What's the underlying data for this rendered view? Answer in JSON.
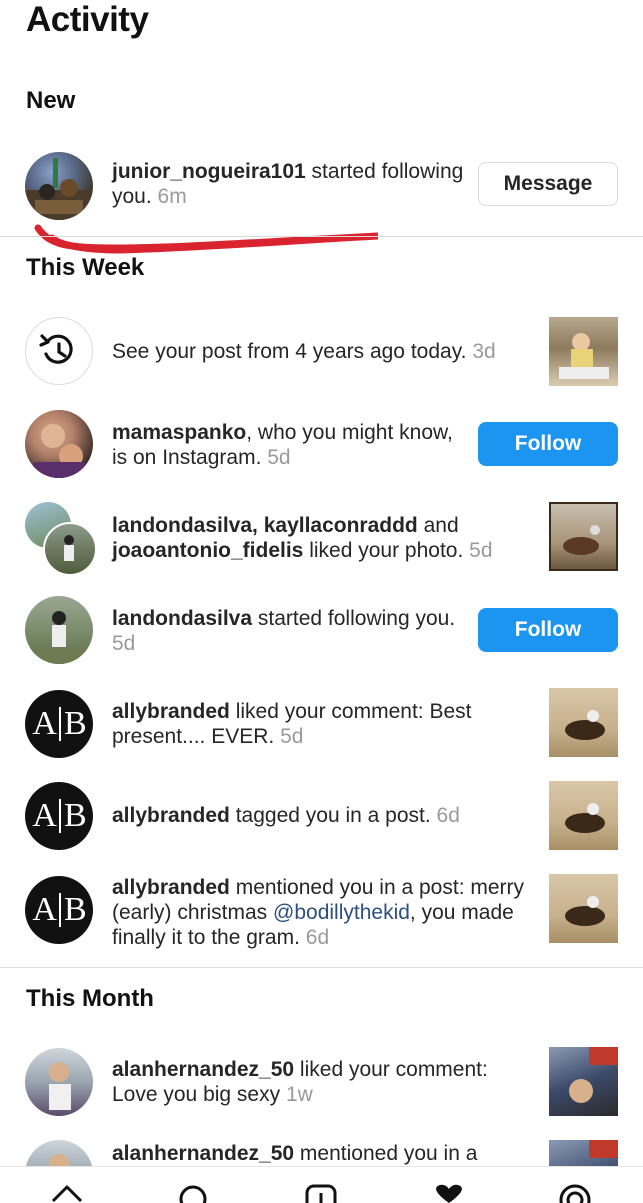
{
  "header": {
    "title": "Activity"
  },
  "sections": {
    "new": "New",
    "this_week": "This Week",
    "this_month": "This Month"
  },
  "new_item": {
    "user": "junior_nogueira101",
    "text": " started following you.",
    "time": "6m",
    "button": "Message"
  },
  "week_items": [
    {
      "user": "",
      "text": "See your post from 4 years ago today.",
      "time": "3d"
    },
    {
      "user": "mamaspanko",
      "text": ", who you might know, is on Instagram.",
      "time": "5d",
      "button": "Follow"
    },
    {
      "user": "landondasilva, kayllaconraddd",
      "mid": " and ",
      "user2": "joaoantonio_fidelis",
      "text": " liked your photo.",
      "time": "5d"
    },
    {
      "user": "landondasilva",
      "text": " started following you.",
      "time": "5d",
      "button": "Follow"
    },
    {
      "user": "allybranded",
      "text": " liked your comment: Best present.... EVER.",
      "time": "5d"
    },
    {
      "user": "allybranded",
      "text": " tagged you in a post.",
      "time": "6d"
    },
    {
      "user": "allybranded",
      "text": " mentioned you in a post: merry (early) christmas ",
      "mention": "@bodillythekid",
      "text2": ", you made finally it to the gram.",
      "time": "6d"
    }
  ],
  "month_items": [
    {
      "user": "alanhernandez_50",
      "text": " liked your comment: Love you big sexy",
      "time": "1w"
    },
    {
      "user": "alanhernandez_50",
      "text": " mentioned you in a"
    }
  ],
  "logo_text": {
    "left": "A",
    "right": "B"
  },
  "colors": {
    "follow_blue": "#1b95f0",
    "annotation_red": "#d9232e",
    "timestamp_gray": "#9a9a9a"
  },
  "icons": [
    "history-icon",
    "home-icon",
    "search-icon",
    "new-post-icon",
    "heart-icon",
    "profile-icon"
  ]
}
